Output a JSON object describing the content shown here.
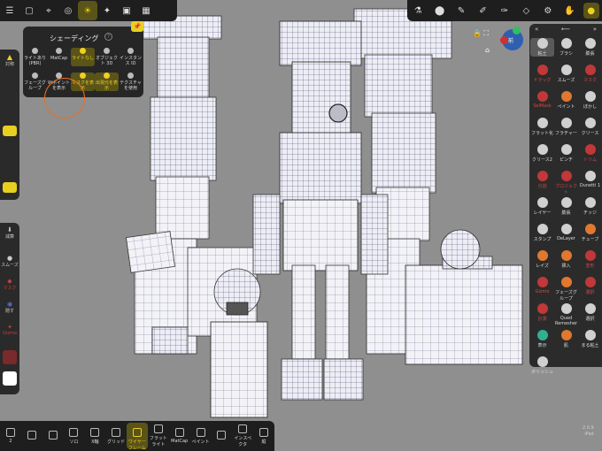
{
  "shading_panel": {
    "title": "シェーディング",
    "help": "?",
    "pin": "📌",
    "row1": [
      "ライトあり (PBR)",
      "MatCap",
      "ライトなし",
      "オブジェクト 3D",
      "インスタンス ID"
    ],
    "row2": [
      "フェーズグループ",
      "Wポイントを表示",
      "マスクを表示",
      "出現元を表示",
      "テクスチャを使用"
    ],
    "active_index": 2
  },
  "top_toolbar": [
    "☰",
    "▢",
    "⌖",
    "◎",
    "☀",
    "✦",
    "▣",
    "▦"
  ],
  "top_right_toolbar": [
    "⚗",
    "⬤",
    "✎",
    "✐",
    "✑",
    "◇",
    "⚙",
    "✋",
    "●"
  ],
  "gizmo_label": "前",
  "left_bar": {
    "symmetry_label": "対称",
    "reduce_label": "減算",
    "smooth_label": "スムーズ",
    "mask_label": "マスク",
    "hide_label": "隠す",
    "gizmo_label": "Gizmo"
  },
  "right_panel": {
    "head_left": "«",
    "head_mid": "⟵",
    "head_right": "»",
    "tools": [
      {
        "label": "粘土",
        "sel": true
      },
      {
        "label": "ブラシ"
      },
      {
        "label": "膨張"
      },
      {
        "label": "ドラッグ",
        "red": true
      },
      {
        "label": "スムーズ"
      },
      {
        "label": "マスク",
        "red": true
      },
      {
        "label": "SelMask",
        "red": true
      },
      {
        "label": "ペイント",
        "orange": true
      },
      {
        "label": "ぼかし"
      },
      {
        "label": "フラット化"
      },
      {
        "label": "フラチャー"
      },
      {
        "label": "クリース"
      },
      {
        "label": "クリース2"
      },
      {
        "label": "ピンチ"
      },
      {
        "label": "トリム",
        "red": true
      },
      {
        "label": "分割",
        "red": true
      },
      {
        "label": "プロジェクト",
        "red": true
      },
      {
        "label": "Dunetti 1"
      },
      {
        "label": "レイヤー"
      },
      {
        "label": "膨張"
      },
      {
        "label": "チッジ"
      },
      {
        "label": "スタンプ"
      },
      {
        "label": "DeLayer"
      },
      {
        "label": "チューブ",
        "orange": true
      },
      {
        "label": "レイズ",
        "orange": true
      },
      {
        "label": "挿入",
        "orange": true
      },
      {
        "label": "変形",
        "red": true
      },
      {
        "label": "Gizmo",
        "red": true
      },
      {
        "label": "フェーズグループ",
        "orange": true
      },
      {
        "label": "選択",
        "red": true
      },
      {
        "label": "計測",
        "red": true
      },
      {
        "label": "Quad Remesher"
      },
      {
        "label": "選択"
      },
      {
        "label": "表示",
        "green": true
      },
      {
        "label": "肌",
        "orange": true
      },
      {
        "label": "まる粘土"
      },
      {
        "label": "ポリッシュ"
      }
    ]
  },
  "bottom_bar": [
    {
      "label": "2"
    },
    {
      "label": ""
    },
    {
      "label": ""
    },
    {
      "label": "ソロ"
    },
    {
      "label": "X軸"
    },
    {
      "label": "グリッド"
    },
    {
      "label": "ワイヤーフレーム",
      "active": true
    },
    {
      "label": "フラットライト"
    },
    {
      "label": "MatCap"
    },
    {
      "label": "ペイント"
    },
    {
      "label": ""
    },
    {
      "label": "インスペクタ"
    },
    {
      "label": "縦"
    }
  ],
  "version": {
    "line1": "2.0.9",
    "line2": "iPad"
  }
}
